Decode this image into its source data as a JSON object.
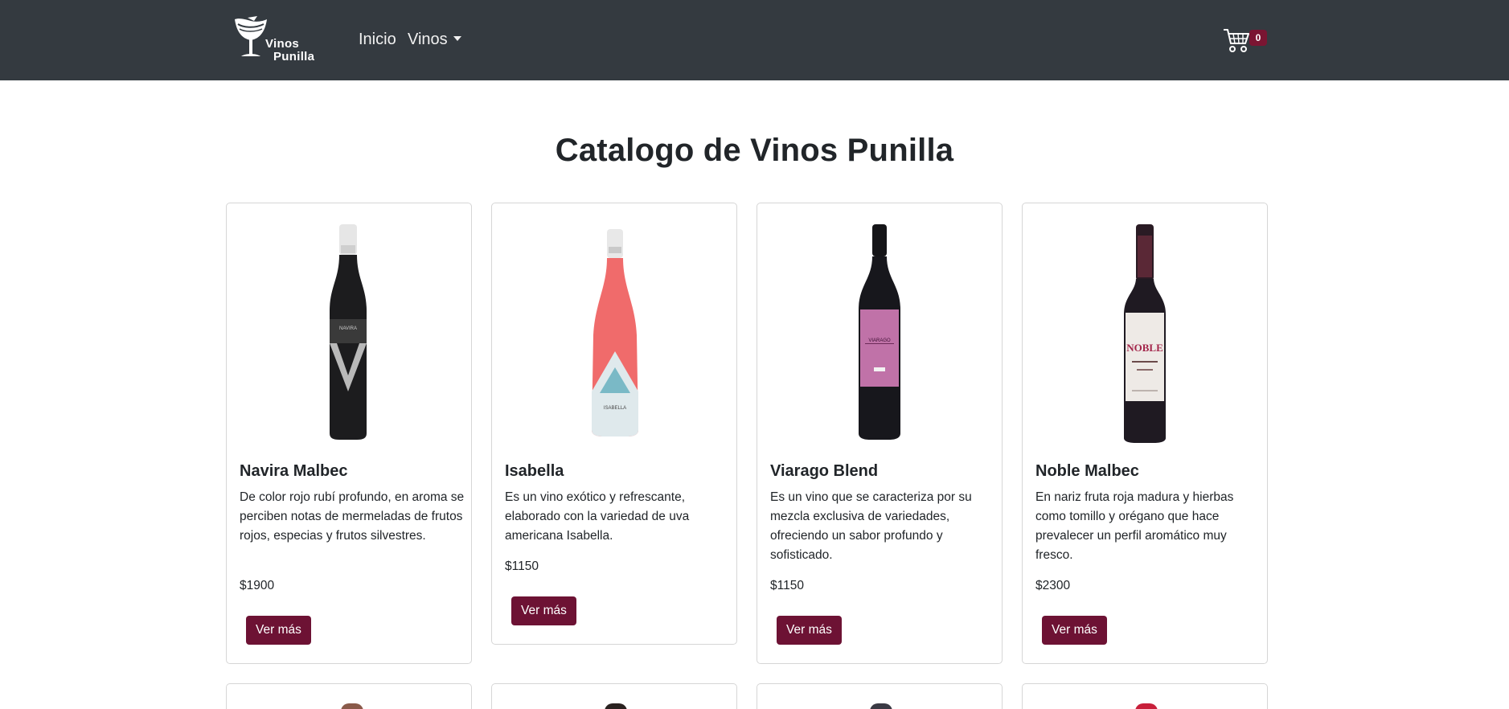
{
  "header": {
    "brand": {
      "line1": "Vinos",
      "line2": "Punilla"
    },
    "nav": [
      {
        "label": "Inicio"
      },
      {
        "label": "Vinos"
      }
    ],
    "cart": {
      "icon": "cart-icon",
      "count": "0"
    }
  },
  "main": {
    "title": "Catalogo de Vinos Punilla",
    "products": [
      {
        "name": "Navira Malbec",
        "description": "De color rojo rubí profundo, en aroma se perciben notas de mermeladas de frutos rojos, especias y frutos silvestres.",
        "price": "$1900",
        "button": "Ver más",
        "label_text": "NAVIRA"
      },
      {
        "name": "Isabella",
        "description": "Es un vino exótico y refrescante, elaborado con la variedad de uva americana Isabella.",
        "price": "$1150",
        "button": "Ver más",
        "label_text": "ISABELLA"
      },
      {
        "name": "Viarago Blend",
        "description": "Es un vino que se caracteriza por su mezcla exclusiva de variedades, ofreciendo un sabor profundo y sofisticado.",
        "price": "$1150",
        "button": "Ver más",
        "label_text": "VIARAGO"
      },
      {
        "name": "Noble Malbec",
        "description": "En nariz fruta roja madura y hierbas como tomillo y orégano que hace prevalecer un perfil aromático muy fresco.",
        "price": "$2300",
        "button": "Ver más",
        "label_text": "NOBLE"
      }
    ]
  },
  "colors": {
    "navbar": "#343a40",
    "accent": "#6d1234",
    "badge": "#7a1532"
  }
}
